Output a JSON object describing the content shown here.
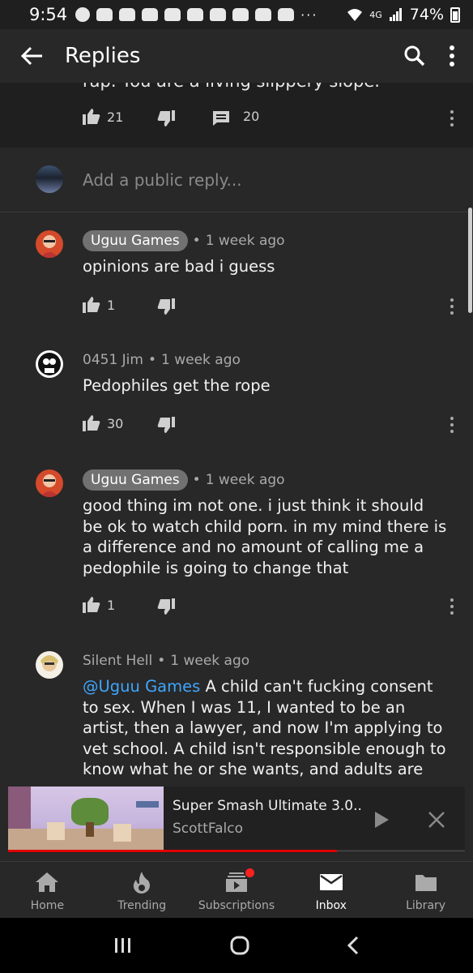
{
  "status_bar": {
    "time": "9:54",
    "notification_overflow": "···",
    "signal_label": "4G",
    "battery": "74%"
  },
  "app_bar": {
    "title": "Replies",
    "back_icon": "back-arrow-icon",
    "search_icon": "search-icon",
    "more_icon": "more-vert-icon"
  },
  "parent_comment": {
    "cutoff_text": "rap. You are a living slippery slope.",
    "likes": "21",
    "replies": "20"
  },
  "reply_box": {
    "placeholder": "Add a public reply..."
  },
  "comments": [
    {
      "author": "Uguu Games",
      "time": "1 week ago",
      "text": "opinions are bad i guess",
      "likes": "1"
    },
    {
      "author": "0451 Jim",
      "time": "1 week ago",
      "text": "Pedophiles get the rope",
      "likes": "30"
    },
    {
      "author": "Uguu Games",
      "time": "1 week ago",
      "text": "good thing im not one. i just think it should be ok to watch child porn. in my mind there is a difference and no amount of calling me a pedophile is going to change that",
      "likes": "1"
    },
    {
      "author": "Silent Hell",
      "time": "1 week ago",
      "mention": "@Uguu Games",
      "text": " A child can't fucking consent to sex. When I was 11, I wanted to be an artist, then a lawyer, and now I'm applying to vet school. A child isn't responsible enough to know what he or she wants, and adults are super"
    }
  ],
  "mini_player": {
    "title": "Super Smash Ultimate 3.0..",
    "channel": "ScottFalco",
    "progress": 0.72,
    "play_icon": "play-icon",
    "close_icon": "close-icon"
  },
  "bottom_nav": [
    {
      "label": "Home",
      "icon": "home-icon"
    },
    {
      "label": "Trending",
      "icon": "trending-flame-icon"
    },
    {
      "label": "Subscriptions",
      "icon": "subscriptions-icon"
    },
    {
      "label": "Inbox",
      "icon": "inbox-mail-icon",
      "active": true
    },
    {
      "label": "Library",
      "icon": "library-folder-icon"
    }
  ],
  "colors": {
    "background": "#282828",
    "mention": "#3ea6ff",
    "progress": "#e00000",
    "badge": "#ff2020"
  }
}
